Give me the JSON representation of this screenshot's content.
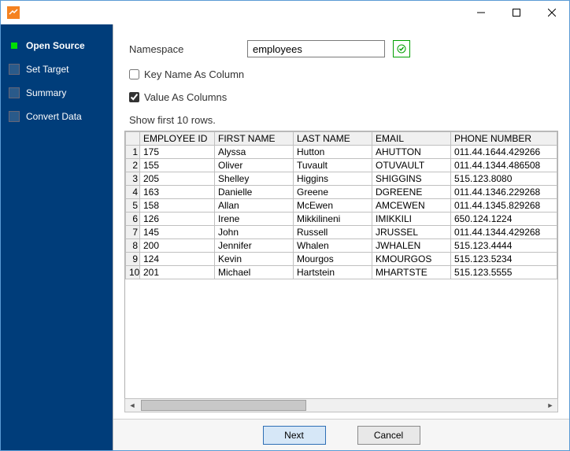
{
  "titlebar": {
    "title": ""
  },
  "sidebar": {
    "steps": [
      {
        "label": "Open Source",
        "active": true
      },
      {
        "label": "Set Target",
        "active": false
      },
      {
        "label": "Summary",
        "active": false
      },
      {
        "label": "Convert Data",
        "active": false
      }
    ]
  },
  "form": {
    "namespace_label": "Namespace",
    "namespace_value": "employees",
    "key_name_as_column_label": "Key Name As Column",
    "key_name_as_column_checked": false,
    "value_as_columns_label": "Value As Columns",
    "value_as_columns_checked": true
  },
  "note": "Show first 10 rows.",
  "table": {
    "headers": [
      "EMPLOYEE ID",
      "FIRST NAME",
      "LAST NAME",
      "EMAIL",
      "PHONE NUMBER"
    ],
    "rows": [
      {
        "n": 1,
        "cols": [
          "175",
          "Alyssa",
          "Hutton",
          "AHUTTON",
          "011.44.1644.429266"
        ]
      },
      {
        "n": 2,
        "cols": [
          "155",
          "Oliver",
          "Tuvault",
          "OTUVAULT",
          "011.44.1344.486508"
        ]
      },
      {
        "n": 3,
        "cols": [
          "205",
          "Shelley",
          "Higgins",
          "SHIGGINS",
          "515.123.8080"
        ]
      },
      {
        "n": 4,
        "cols": [
          "163",
          "Danielle",
          "Greene",
          "DGREENE",
          "011.44.1346.229268"
        ]
      },
      {
        "n": 5,
        "cols": [
          "158",
          "Allan",
          "McEwen",
          "AMCEWEN",
          "011.44.1345.829268"
        ]
      },
      {
        "n": 6,
        "cols": [
          "126",
          "Irene",
          "Mikkilineni",
          "IMIKKILI",
          "650.124.1224"
        ]
      },
      {
        "n": 7,
        "cols": [
          "145",
          "John",
          "Russell",
          "JRUSSEL",
          "011.44.1344.429268"
        ]
      },
      {
        "n": 8,
        "cols": [
          "200",
          "Jennifer",
          "Whalen",
          "JWHALEN",
          "515.123.4444"
        ]
      },
      {
        "n": 9,
        "cols": [
          "124",
          "Kevin",
          "Mourgos",
          "KMOURGOS",
          "515.123.5234"
        ]
      },
      {
        "n": 10,
        "cols": [
          "201",
          "Michael",
          "Hartstein",
          "MHARTSTE",
          "515.123.5555"
        ]
      }
    ]
  },
  "buttons": {
    "next": "Next",
    "cancel": "Cancel"
  }
}
